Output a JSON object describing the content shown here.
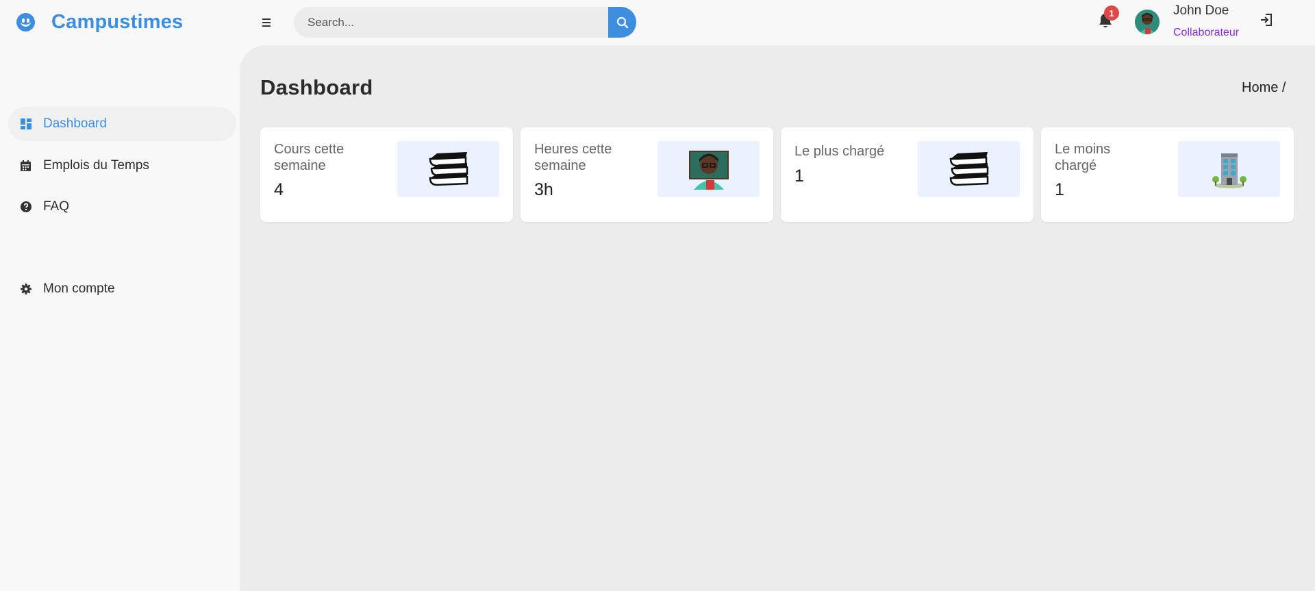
{
  "app": {
    "name": "Campustimes"
  },
  "search": {
    "placeholder": "Search..."
  },
  "notifications": {
    "count": "1"
  },
  "user": {
    "name": "John Doe",
    "role": "Collaborateur"
  },
  "sidebar": {
    "items": [
      {
        "label": "Dashboard",
        "icon": "dashboard-icon",
        "active": true
      },
      {
        "label": "Emplois du Temps",
        "icon": "calendar-icon",
        "active": false
      },
      {
        "label": "FAQ",
        "icon": "question-circle-icon",
        "active": false
      },
      {
        "label": "Mon compte",
        "icon": "gear-icon",
        "active": false
      }
    ]
  },
  "page": {
    "title": "Dashboard",
    "breadcrumb": "Home /"
  },
  "cards": [
    {
      "label": "Cours cette semaine",
      "value": "4",
      "icon": "books-icon"
    },
    {
      "label": "Heures cette semaine",
      "value": "3h",
      "icon": "teacher-icon"
    },
    {
      "label": "Le plus chargé",
      "value": "1",
      "icon": "books-icon"
    },
    {
      "label": "Le moins chargé",
      "value": "1",
      "icon": "building-icon"
    }
  ],
  "colors": {
    "accent": "#3e8ee0",
    "role": "#8a2be2",
    "badge": "#e04848",
    "card_img_bg": "#eaf2ff"
  }
}
